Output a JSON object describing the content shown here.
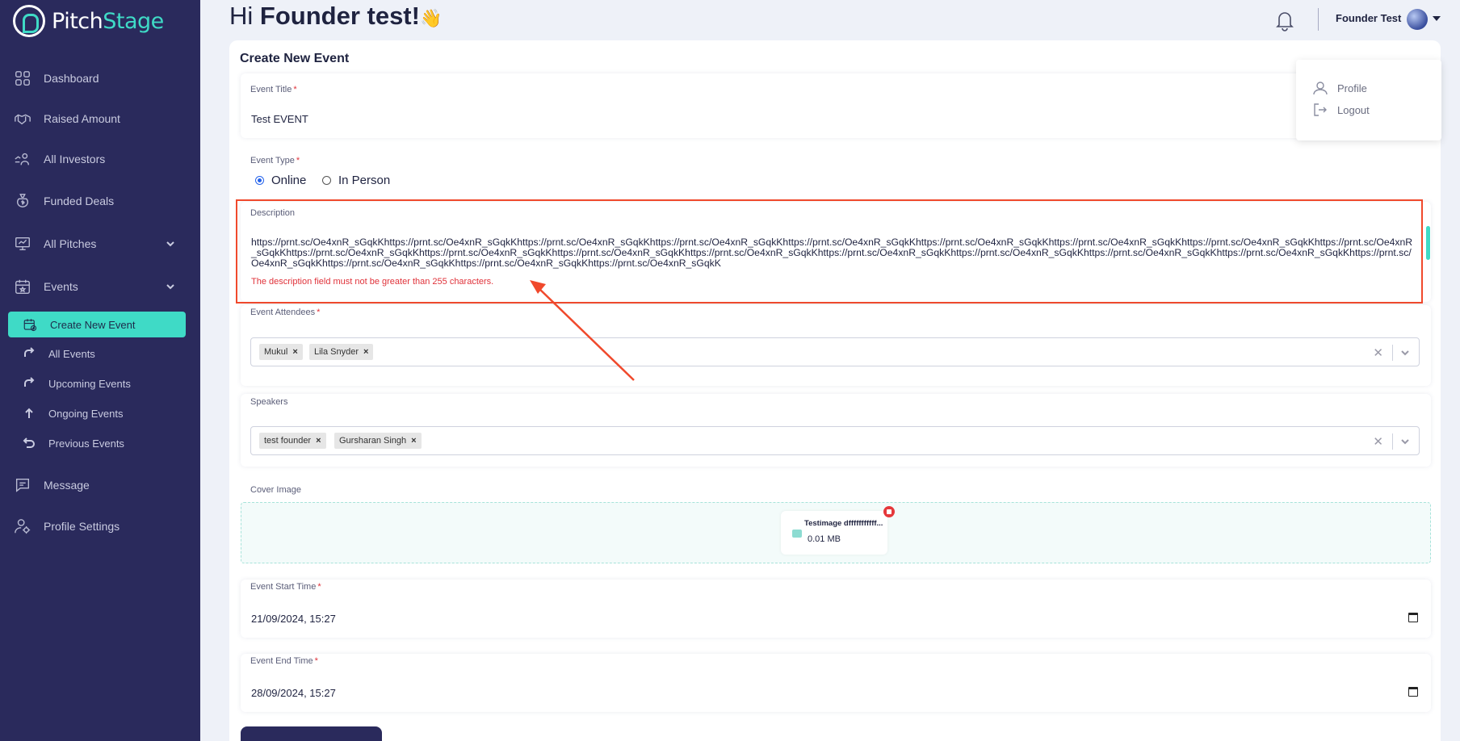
{
  "app": {
    "logo_text_a": "Pitch",
    "logo_text_b": "Stage"
  },
  "sidebar": {
    "items": [
      {
        "label": "Dashboard",
        "icon": "dashboard-icon"
      },
      {
        "label": "Raised Amount",
        "icon": "handshake-icon"
      },
      {
        "label": "All Investors",
        "icon": "investors-icon"
      },
      {
        "label": "Funded Deals",
        "icon": "money-bag-icon"
      },
      {
        "label": "All Pitches",
        "icon": "presentation-icon"
      },
      {
        "label": "Events",
        "icon": "calendar-icon"
      },
      {
        "label": "Message",
        "icon": "chat-icon"
      },
      {
        "label": "Profile Settings",
        "icon": "user-settings-icon"
      }
    ],
    "events_submenu": [
      {
        "label": "Create New Event",
        "icon": "calendar-add-icon",
        "active": true
      },
      {
        "label": "All Events",
        "icon": "repeat-icon"
      },
      {
        "label": "Upcoming Events",
        "icon": "repeat-icon"
      },
      {
        "label": "Ongoing Events",
        "icon": "arrow-up-icon"
      },
      {
        "label": "Previous Events",
        "icon": "undo-icon"
      }
    ]
  },
  "header": {
    "greeting_prefix": "Hi",
    "greeting_name": "Founder test!",
    "greeting_emoji": "👋",
    "user_name": "Founder Test"
  },
  "user_menu": {
    "profile": "Profile",
    "logout": "Logout"
  },
  "form": {
    "title": "Create New Event",
    "event_title": {
      "label": "Event Title",
      "value": "Test EVENT"
    },
    "event_type": {
      "label": "Event Type",
      "options": [
        "Online",
        "In Person"
      ],
      "selected": "Online"
    },
    "description": {
      "label": "Description",
      "value": "https://prnt.sc/Oe4xnR_sGqkKhttps://prnt.sc/Oe4xnR_sGqkKhttps://prnt.sc/Oe4xnR_sGqkKhttps://prnt.sc/Oe4xnR_sGqkKhttps://prnt.sc/Oe4xnR_sGqkKhttps://prnt.sc/Oe4xnR_sGqkKhttps://prnt.sc/Oe4xnR_sGqkKhttps://prnt.sc/Oe4xnR_sGqkKhttps://prnt.sc/Oe4xnR_sGqkKhttps://prnt.sc/Oe4xnR_sGqkKhttps://prnt.sc/Oe4xnR_sGqkKhttps://prnt.sc/Oe4xnR_sGqkKhttps://prnt.sc/Oe4xnR_sGqkKhttps://prnt.sc/Oe4xnR_sGqkKhttps://prnt.sc/Oe4xnR_sGqkKhttps://prnt.sc/Oe4xnR_sGqkKhttps://prnt.sc/Oe4xnR_sGqkKhttps://prnt.sc/Oe4xnR_sGqkKhttps://prnt.sc/Oe4xnR_sGqkKhttps://prnt.sc/Oe4xnR_sGqkKhttps://prnt.sc/Oe4xnR_sGqkK",
      "error": "The description field must not be greater than 255 characters."
    },
    "attendees": {
      "label": "Event Attendees",
      "tags": [
        "Mukul",
        "Lila Snyder"
      ]
    },
    "speakers": {
      "label": "Speakers",
      "tags": [
        "test founder",
        "Gursharan Singh"
      ]
    },
    "cover_image": {
      "label": "Cover Image",
      "file_name": "Testimage dfffffffffff...",
      "file_size": "0.01 MB"
    },
    "start_time": {
      "label": "Event Start Time",
      "value": "21/09/2024, 15:27"
    },
    "end_time": {
      "label": "Event End Time",
      "value": "28/09/2024, 15:27"
    }
  },
  "colors": {
    "sidebar": "#2a2a5c",
    "accent": "#3fdac6",
    "error": "#e0323a",
    "annotation": "#f0492c"
  }
}
